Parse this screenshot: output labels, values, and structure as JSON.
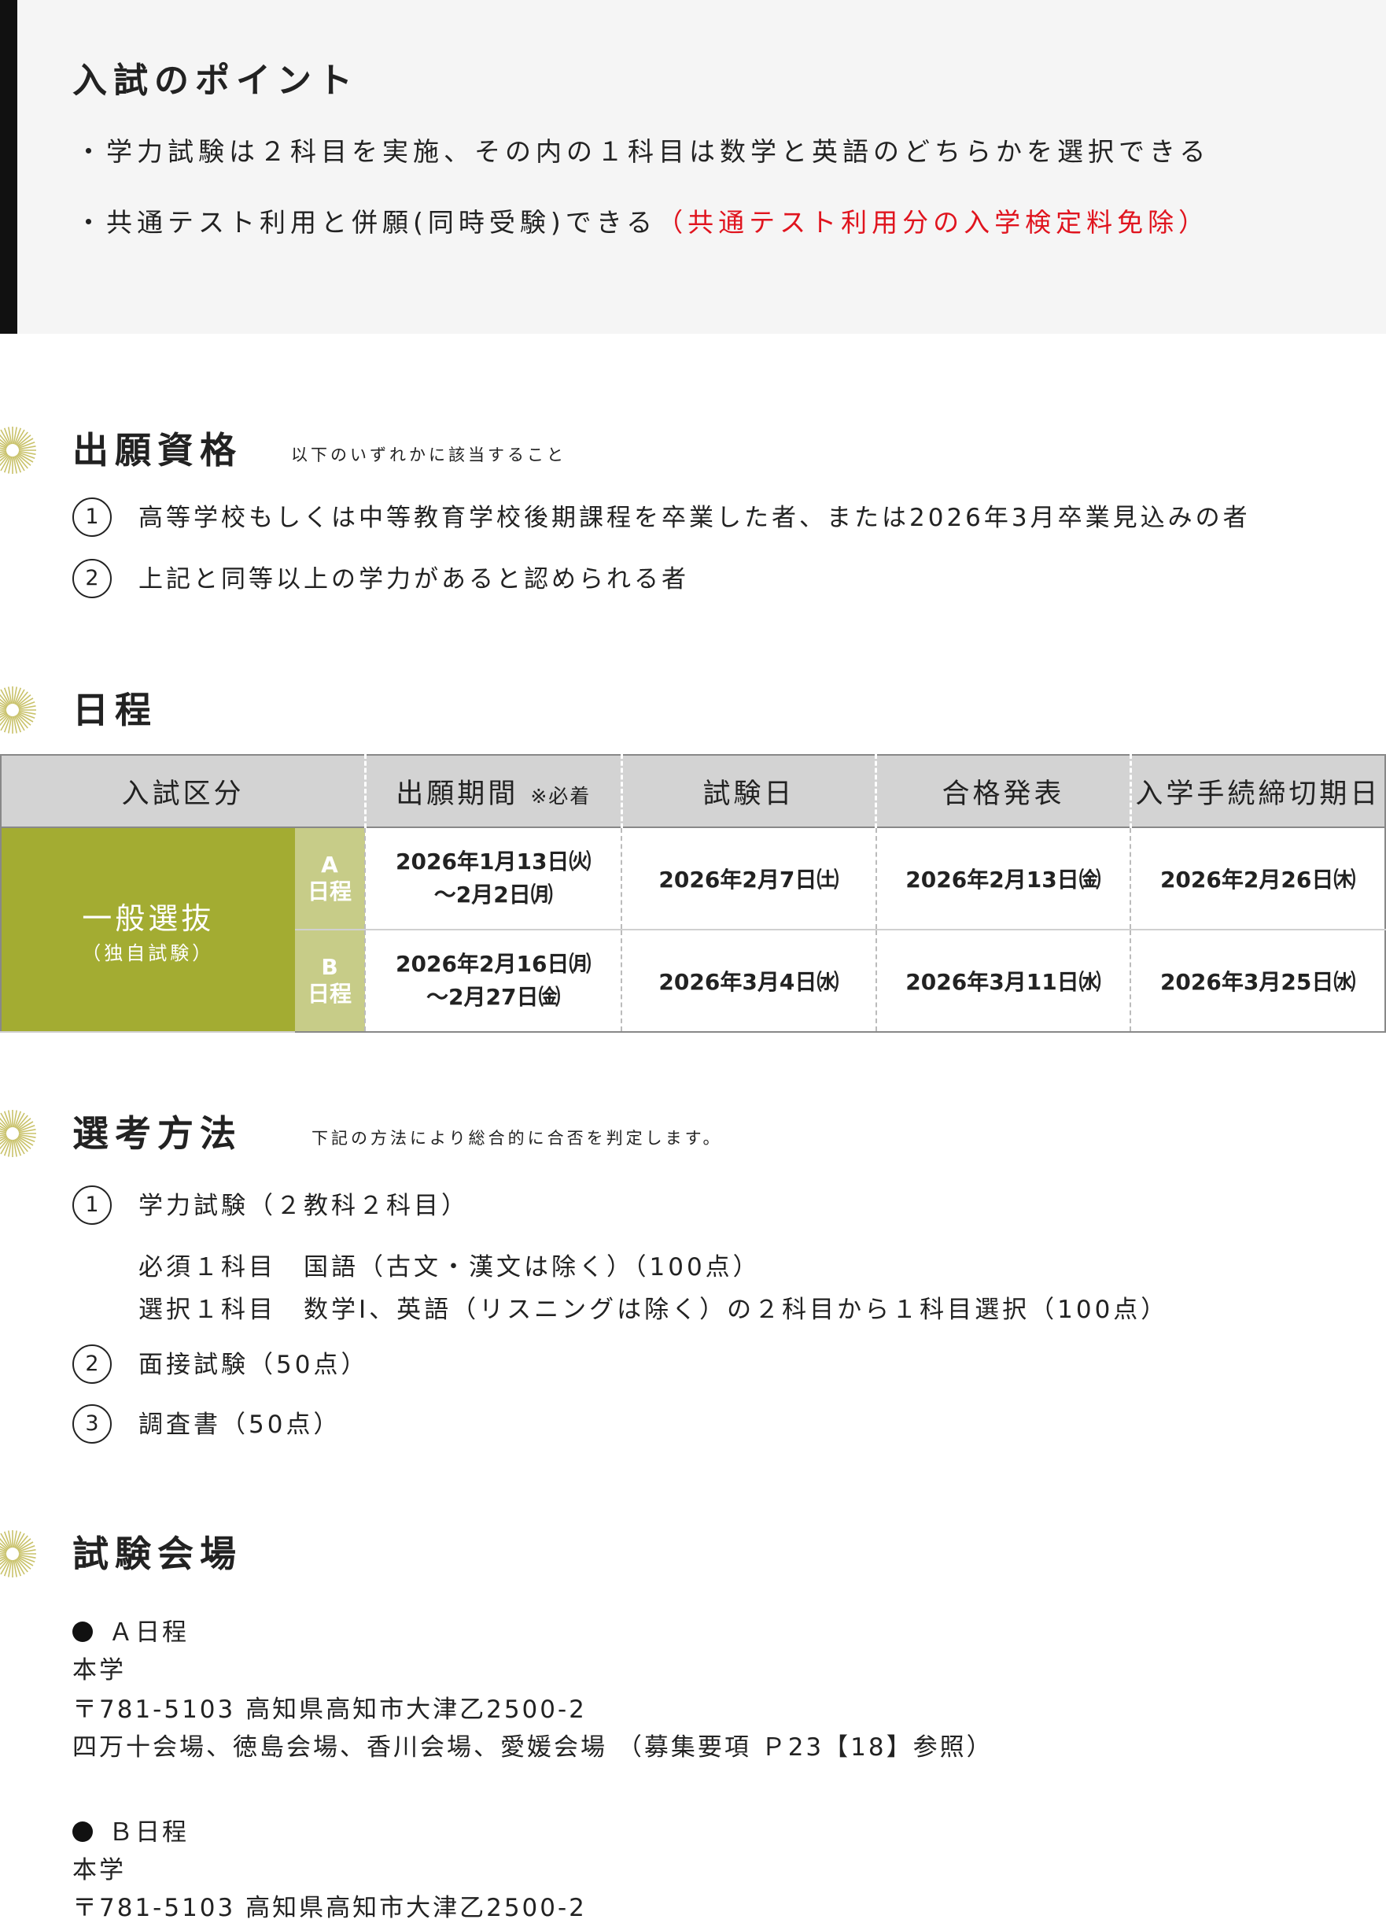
{
  "points": {
    "title": "入試のポイント",
    "line1": "・学力試験は２科目を実施、その内の１科目は数学と英語のどちらかを選択できる",
    "line2_a": "・共通テスト利用と併願(同時受験)できる",
    "line2_b": "（共通テスト利用分の入学検定料免除）"
  },
  "eligibility": {
    "title": "出願資格",
    "note": "以下のいずれかに該当すること",
    "items": [
      {
        "num": "1",
        "text": "高等学校もしくは中等教育学校後期課程を卒業した者、または2026年3月卒業見込みの者"
      },
      {
        "num": "2",
        "text": "上記と同等以上の学力があると認められる者"
      }
    ]
  },
  "schedule": {
    "title": "日程",
    "headers": {
      "category": "入試区分",
      "period": "出願期間",
      "period_note": "※必着",
      "exam_date": "試験日",
      "result": "合格発表",
      "deadline": "入学手続締切期日"
    },
    "category": {
      "main": "一般選抜",
      "sub": "（独自試験）"
    },
    "rows": [
      {
        "sub_letter": "A",
        "sub_label": "日程",
        "period_start": "2026年1月13日㈫",
        "period_end": "～2月2日㈪",
        "exam": "2026年2月7日㈯",
        "result": "2026年2月13日㈮",
        "deadline": "2026年2月26日㈭"
      },
      {
        "sub_letter": "B",
        "sub_label": "日程",
        "period_start": "2026年2月16日㈪",
        "period_end": "～2月27日㈮",
        "exam": "2026年3月4日㈬",
        "result": "2026年3月11日㈬",
        "deadline": "2026年3月25日㈬"
      }
    ]
  },
  "selection": {
    "title": "選考方法",
    "note": "下記の方法により総合的に合否を判定します。",
    "item1": {
      "num": "1",
      "text": "学力試験（２教科２科目）"
    },
    "item1_lines": [
      "必須１科目　国語（古文・漢文は除く）（100点）",
      "選択１科目　数学Ⅰ、英語（リスニングは除く）の２科目から１科目選択（100点）"
    ],
    "item2": {
      "num": "2",
      "text": "面接試験（50点）"
    },
    "item3": {
      "num": "3",
      "text": "調査書（50点）"
    }
  },
  "venue": {
    "title": "試験会場",
    "a": {
      "label": "Ａ日程",
      "place": "本学",
      "address": "〒781-5103 高知県高知市大津乙2500-2",
      "others": "四万十会場、徳島会場、香川会場、愛媛会場 （募集要項 Ｐ23【18】参照）"
    },
    "b": {
      "label": "Ｂ日程",
      "place": "本学",
      "address": "〒781-5103 高知県高知市大津乙2500-2"
    }
  },
  "colors": {
    "accent_green": "#a3ac32",
    "accent_green_light": "#c7cc88",
    "highlight_red": "#e0141e",
    "sun_icon": "#c9c26a"
  }
}
